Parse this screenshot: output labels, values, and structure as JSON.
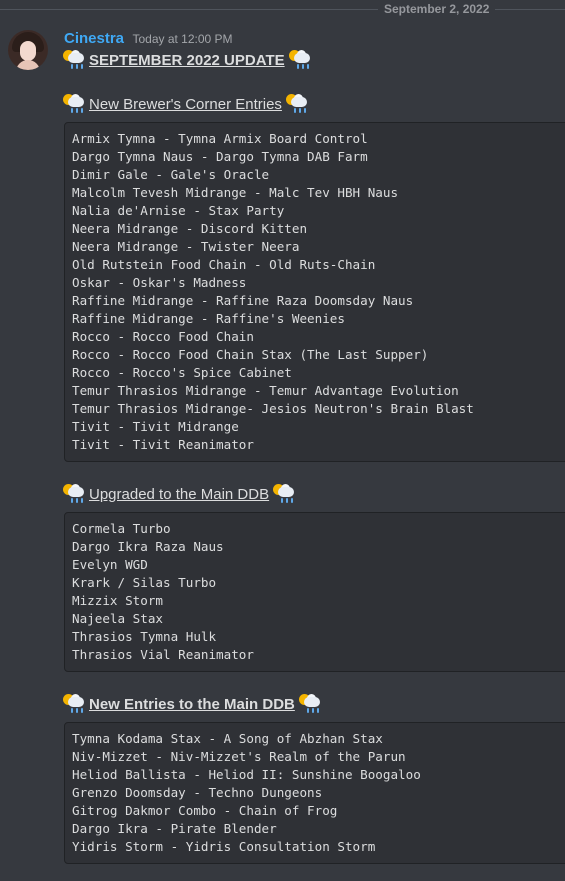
{
  "date_divider": "September 2, 2022",
  "message": {
    "username": "Cinestra",
    "timestamp": "Today at 12:00 PM",
    "title": "SEPTEMBER 2022 UPDATE",
    "emoji_icon": "sun-behind-rain-cloud-icon"
  },
  "sections": [
    {
      "heading": "New Brewer's Corner Entries",
      "lines": [
        "Armix Tymna - Tymna Armix Board Control",
        "Dargo Tymna Naus - Dargo Tymna DAB Farm",
        "Dimir Gale - Gale's Oracle",
        "Malcolm Tevesh Midrange - Malc Tev HBH Naus",
        "Nalia de'Arnise - Stax Party",
        "Neera Midrange - Discord Kitten",
        "Neera Midrange - Twister Neera",
        "Old Rutstein Food Chain - Old Ruts-Chain",
        "Oskar - Oskar's Madness",
        "Raffine Midrange - Raffine Raza Doomsday Naus",
        "Raffine Midrange - Raffine's Weenies",
        "Rocco - Rocco Food Chain",
        "Rocco - Rocco Food Chain Stax (The Last Supper)",
        "Rocco - Rocco's Spice Cabinet",
        "Temur Thrasios Midrange - Temur Advantage Evolution",
        "Temur Thrasios Midrange- Jesios Neutron's Brain Blast",
        "Tivit - Tivit Midrange",
        "Tivit - Tivit Reanimator"
      ]
    },
    {
      "heading": "Upgraded to the Main DDB",
      "lines": [
        "Cormela Turbo",
        "Dargo Ikra Raza Naus",
        "Evelyn WGD",
        "Krark / Silas Turbo",
        "Mizzix Storm",
        "Najeela Stax",
        "Thrasios Tymna Hulk",
        "Thrasios Vial Reanimator"
      ]
    },
    {
      "heading": "New Entries to the Main DDB",
      "lines": [
        "Tymna Kodama Stax - A Song of Abzhan Stax",
        "Niv-Mizzet - Niv-Mizzet's Realm of the Parun",
        "Heliod Ballista - Heliod II: Sunshine Boogaloo",
        "Grenzo Doomsday - Techno Dungeons",
        "Gitrog Dakmor Combo - Chain of Frog",
        "Dargo Ikra - Pirate Blender",
        "Yidris Storm - Yidris Consultation Storm"
      ]
    }
  ]
}
